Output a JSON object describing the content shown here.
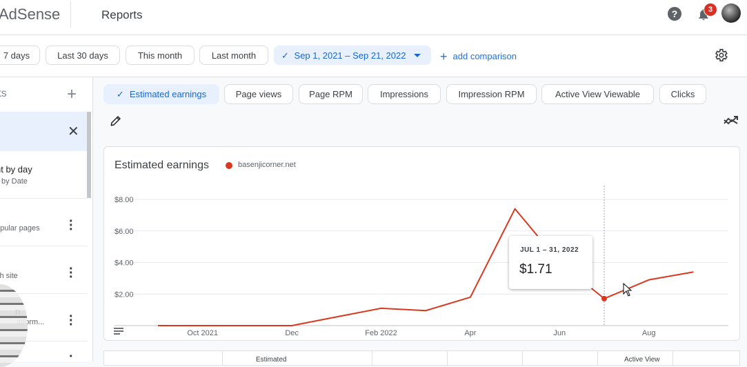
{
  "header": {
    "brand": "AdSense",
    "title": "Reports",
    "notification_count": "3"
  },
  "date_range": {
    "presets": [
      "7 days",
      "Last 30 days",
      "This month",
      "Last month"
    ],
    "selected": "Sep 1, 2021 – Sep 21, 2022",
    "add_comparison": "add comparison"
  },
  "sidebar": {
    "header": "rts",
    "items": [
      {
        "title": "nt by day",
        "subtitle": "by Date"
      },
      {
        "subtitle": "opular pages"
      },
      {
        "subtitle": "ch site"
      },
      {
        "title": "n",
        "subtitle": "atform..."
      }
    ]
  },
  "metrics": [
    "Estimated earnings",
    "Page views",
    "Page RPM",
    "Impressions",
    "Impression RPM",
    "Active View Viewable",
    "Clicks"
  ],
  "chart_data": {
    "type": "line",
    "title": "Estimated earnings",
    "series": [
      {
        "name": "basenjicorner.net",
        "color": "#d9381e",
        "points": [
          {
            "x": "2021-09",
            "y": 0.0
          },
          {
            "x": "2021-10",
            "y": 0.0
          },
          {
            "x": "2021-11",
            "y": 0.0
          },
          {
            "x": "2021-12",
            "y": 0.0
          },
          {
            "x": "2022-01",
            "y": 0.55
          },
          {
            "x": "2022-02",
            "y": 1.1
          },
          {
            "x": "2022-03",
            "y": 0.95
          },
          {
            "x": "2022-04",
            "y": 1.8
          },
          {
            "x": "2022-05",
            "y": 7.4
          },
          {
            "x": "2022-06",
            "y": 4.0
          },
          {
            "x": "2022-07",
            "y": 1.71
          },
          {
            "x": "2022-08",
            "y": 2.9
          },
          {
            "x": "2022-09",
            "y": 3.4
          }
        ]
      }
    ],
    "x_tick_labels": [
      "Oct 2021",
      "Dec",
      "Feb 2022",
      "Apr",
      "Jun",
      "Aug"
    ],
    "y_tick_labels": [
      "$2.00",
      "$4.00",
      "$6.00",
      "$8.00"
    ],
    "ylim": [
      0,
      8
    ],
    "grid": true,
    "legend": "top-left",
    "tooltip": {
      "date": "JUL 1 – 31, 2022",
      "value": "$1.71"
    }
  },
  "table": {
    "headers": [
      "Estimated",
      "Active View"
    ]
  }
}
